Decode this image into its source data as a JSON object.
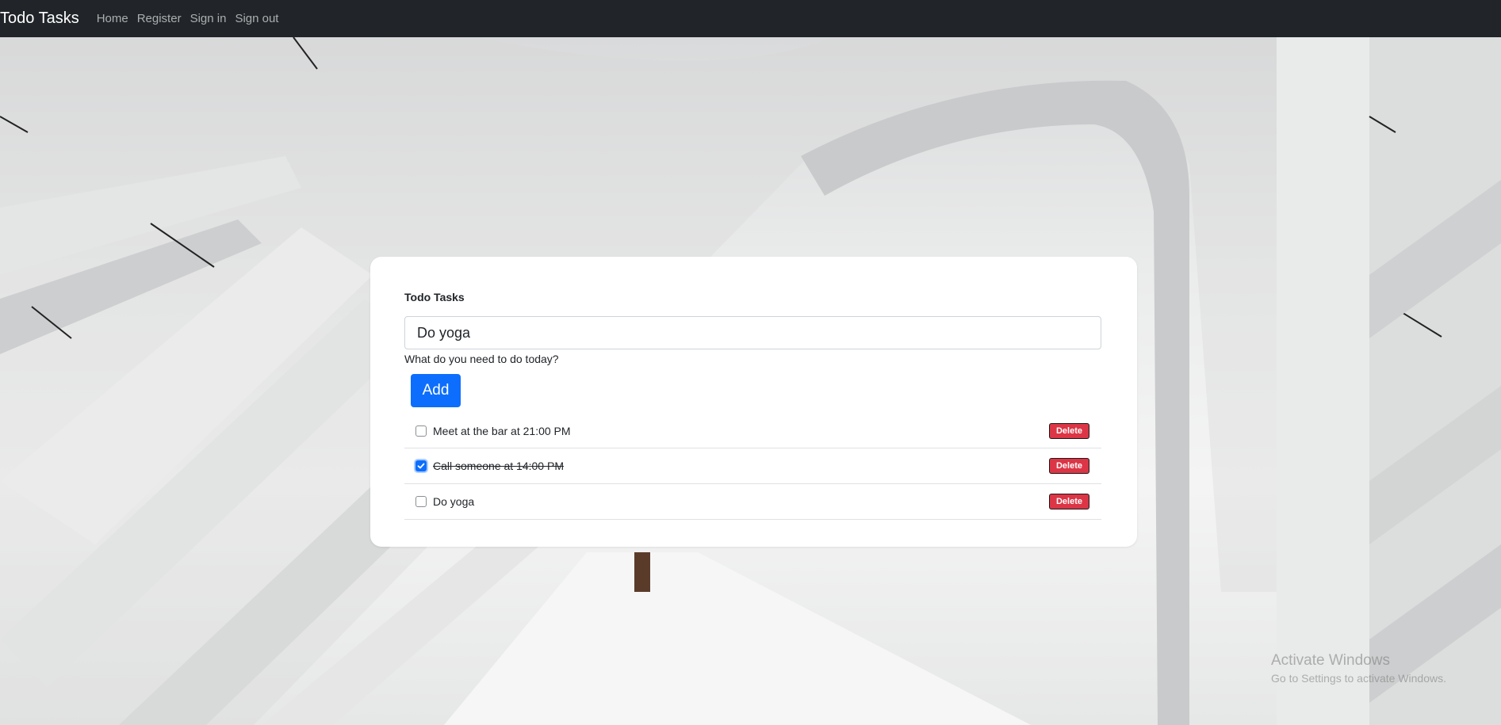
{
  "navbar": {
    "brand": "Todo Tasks",
    "links": [
      "Home",
      "Register",
      "Sign in",
      "Sign out"
    ]
  },
  "card": {
    "title": "Todo Tasks",
    "input": {
      "value": "Do yoga"
    },
    "help_text": "What do you need to do today?",
    "add_label": "Add",
    "tasks": [
      {
        "text": "Meet at the bar at 21:00 PM",
        "done": false,
        "delete_label": "Delete"
      },
      {
        "text": "Call someone at 14:00 PM",
        "done": true,
        "delete_label": "Delete"
      },
      {
        "text": "Do yoga",
        "done": false,
        "delete_label": "Delete"
      }
    ]
  },
  "watermark": {
    "line1": "Activate Windows",
    "line2": "Go to Settings to activate Windows."
  },
  "colors": {
    "navbar": "#212529",
    "primary": "#0d6efd",
    "danger": "#dc3545"
  },
  "icons": {
    "checkbox_checked": "check-icon"
  }
}
